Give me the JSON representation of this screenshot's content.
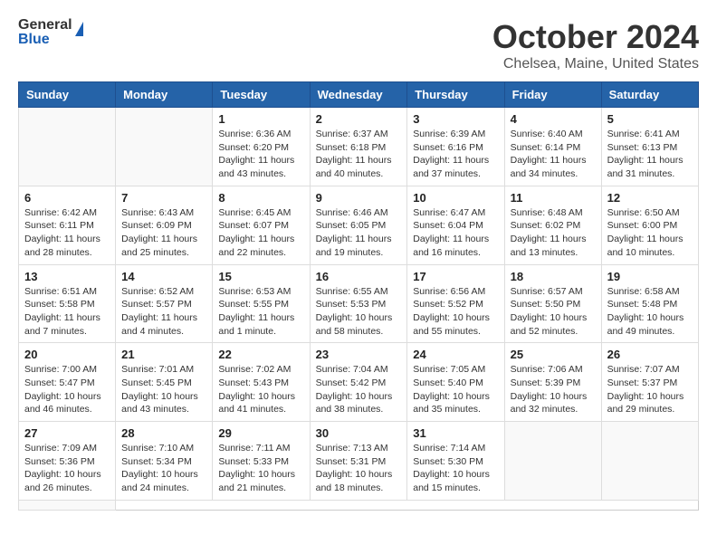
{
  "header": {
    "logo_general": "General",
    "logo_blue": "Blue",
    "month_title": "October 2024",
    "location": "Chelsea, Maine, United States"
  },
  "weekdays": [
    "Sunday",
    "Monday",
    "Tuesday",
    "Wednesday",
    "Thursday",
    "Friday",
    "Saturday"
  ],
  "days": [
    {
      "num": "",
      "empty": true
    },
    {
      "num": "",
      "empty": true
    },
    {
      "num": "1",
      "sunrise": "Sunrise: 6:36 AM",
      "sunset": "Sunset: 6:20 PM",
      "daylight": "Daylight: 11 hours and 43 minutes."
    },
    {
      "num": "2",
      "sunrise": "Sunrise: 6:37 AM",
      "sunset": "Sunset: 6:18 PM",
      "daylight": "Daylight: 11 hours and 40 minutes."
    },
    {
      "num": "3",
      "sunrise": "Sunrise: 6:39 AM",
      "sunset": "Sunset: 6:16 PM",
      "daylight": "Daylight: 11 hours and 37 minutes."
    },
    {
      "num": "4",
      "sunrise": "Sunrise: 6:40 AM",
      "sunset": "Sunset: 6:14 PM",
      "daylight": "Daylight: 11 hours and 34 minutes."
    },
    {
      "num": "5",
      "sunrise": "Sunrise: 6:41 AM",
      "sunset": "Sunset: 6:13 PM",
      "daylight": "Daylight: 11 hours and 31 minutes."
    },
    {
      "num": "6",
      "sunrise": "Sunrise: 6:42 AM",
      "sunset": "Sunset: 6:11 PM",
      "daylight": "Daylight: 11 hours and 28 minutes."
    },
    {
      "num": "7",
      "sunrise": "Sunrise: 6:43 AM",
      "sunset": "Sunset: 6:09 PM",
      "daylight": "Daylight: 11 hours and 25 minutes."
    },
    {
      "num": "8",
      "sunrise": "Sunrise: 6:45 AM",
      "sunset": "Sunset: 6:07 PM",
      "daylight": "Daylight: 11 hours and 22 minutes."
    },
    {
      "num": "9",
      "sunrise": "Sunrise: 6:46 AM",
      "sunset": "Sunset: 6:05 PM",
      "daylight": "Daylight: 11 hours and 19 minutes."
    },
    {
      "num": "10",
      "sunrise": "Sunrise: 6:47 AM",
      "sunset": "Sunset: 6:04 PM",
      "daylight": "Daylight: 11 hours and 16 minutes."
    },
    {
      "num": "11",
      "sunrise": "Sunrise: 6:48 AM",
      "sunset": "Sunset: 6:02 PM",
      "daylight": "Daylight: 11 hours and 13 minutes."
    },
    {
      "num": "12",
      "sunrise": "Sunrise: 6:50 AM",
      "sunset": "Sunset: 6:00 PM",
      "daylight": "Daylight: 11 hours and 10 minutes."
    },
    {
      "num": "13",
      "sunrise": "Sunrise: 6:51 AM",
      "sunset": "Sunset: 5:58 PM",
      "daylight": "Daylight: 11 hours and 7 minutes."
    },
    {
      "num": "14",
      "sunrise": "Sunrise: 6:52 AM",
      "sunset": "Sunset: 5:57 PM",
      "daylight": "Daylight: 11 hours and 4 minutes."
    },
    {
      "num": "15",
      "sunrise": "Sunrise: 6:53 AM",
      "sunset": "Sunset: 5:55 PM",
      "daylight": "Daylight: 11 hours and 1 minute."
    },
    {
      "num": "16",
      "sunrise": "Sunrise: 6:55 AM",
      "sunset": "Sunset: 5:53 PM",
      "daylight": "Daylight: 10 hours and 58 minutes."
    },
    {
      "num": "17",
      "sunrise": "Sunrise: 6:56 AM",
      "sunset": "Sunset: 5:52 PM",
      "daylight": "Daylight: 10 hours and 55 minutes."
    },
    {
      "num": "18",
      "sunrise": "Sunrise: 6:57 AM",
      "sunset": "Sunset: 5:50 PM",
      "daylight": "Daylight: 10 hours and 52 minutes."
    },
    {
      "num": "19",
      "sunrise": "Sunrise: 6:58 AM",
      "sunset": "Sunset: 5:48 PM",
      "daylight": "Daylight: 10 hours and 49 minutes."
    },
    {
      "num": "20",
      "sunrise": "Sunrise: 7:00 AM",
      "sunset": "Sunset: 5:47 PM",
      "daylight": "Daylight: 10 hours and 46 minutes."
    },
    {
      "num": "21",
      "sunrise": "Sunrise: 7:01 AM",
      "sunset": "Sunset: 5:45 PM",
      "daylight": "Daylight: 10 hours and 43 minutes."
    },
    {
      "num": "22",
      "sunrise": "Sunrise: 7:02 AM",
      "sunset": "Sunset: 5:43 PM",
      "daylight": "Daylight: 10 hours and 41 minutes."
    },
    {
      "num": "23",
      "sunrise": "Sunrise: 7:04 AM",
      "sunset": "Sunset: 5:42 PM",
      "daylight": "Daylight: 10 hours and 38 minutes."
    },
    {
      "num": "24",
      "sunrise": "Sunrise: 7:05 AM",
      "sunset": "Sunset: 5:40 PM",
      "daylight": "Daylight: 10 hours and 35 minutes."
    },
    {
      "num": "25",
      "sunrise": "Sunrise: 7:06 AM",
      "sunset": "Sunset: 5:39 PM",
      "daylight": "Daylight: 10 hours and 32 minutes."
    },
    {
      "num": "26",
      "sunrise": "Sunrise: 7:07 AM",
      "sunset": "Sunset: 5:37 PM",
      "daylight": "Daylight: 10 hours and 29 minutes."
    },
    {
      "num": "27",
      "sunrise": "Sunrise: 7:09 AM",
      "sunset": "Sunset: 5:36 PM",
      "daylight": "Daylight: 10 hours and 26 minutes."
    },
    {
      "num": "28",
      "sunrise": "Sunrise: 7:10 AM",
      "sunset": "Sunset: 5:34 PM",
      "daylight": "Daylight: 10 hours and 24 minutes."
    },
    {
      "num": "29",
      "sunrise": "Sunrise: 7:11 AM",
      "sunset": "Sunset: 5:33 PM",
      "daylight": "Daylight: 10 hours and 21 minutes."
    },
    {
      "num": "30",
      "sunrise": "Sunrise: 7:13 AM",
      "sunset": "Sunset: 5:31 PM",
      "daylight": "Daylight: 10 hours and 18 minutes."
    },
    {
      "num": "31",
      "sunrise": "Sunrise: 7:14 AM",
      "sunset": "Sunset: 5:30 PM",
      "daylight": "Daylight: 10 hours and 15 minutes."
    },
    {
      "num": "",
      "empty": true
    },
    {
      "num": "",
      "empty": true
    },
    {
      "num": "",
      "empty": true
    }
  ]
}
